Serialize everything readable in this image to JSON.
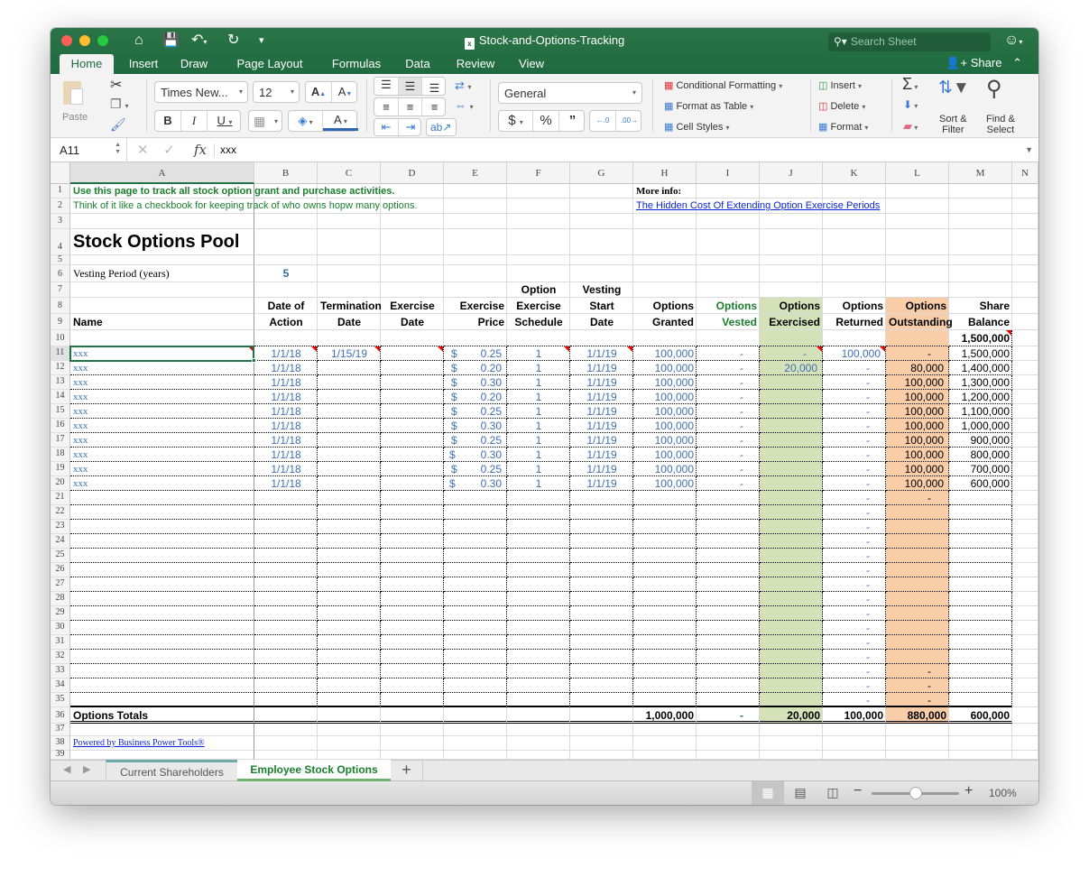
{
  "window": {
    "title": "Stock-and-Options-Tracking",
    "search_placeholder": "Search Sheet",
    "share_label": "Share"
  },
  "ribbon_tabs": [
    "Home",
    "Insert",
    "Draw",
    "Page Layout",
    "Formulas",
    "Data",
    "Review",
    "View"
  ],
  "ribbon": {
    "paste_label": "Paste",
    "font_name": "Times New...",
    "font_size": "12",
    "number_format": "General",
    "conditional_formatting": "Conditional Formatting",
    "format_as_table": "Format as Table",
    "cell_styles": "Cell Styles",
    "insert": "Insert",
    "delete": "Delete",
    "format": "Format",
    "sort_filter": [
      "Sort &",
      "Filter"
    ],
    "find_select": [
      "Find &",
      "Select"
    ]
  },
  "formula_bar": {
    "name_box": "A11",
    "value": "xxx"
  },
  "columns": [
    "A",
    "B",
    "C",
    "D",
    "E",
    "F",
    "G",
    "H",
    "I",
    "J",
    "K",
    "L",
    "M",
    "N"
  ],
  "sheet": {
    "intro_line1": "Use this page to track all stock option grant and purchase activities.",
    "intro_line2": "Think of it like a checkbook for keeping track of who owns hopw many options.",
    "more_info_label": "More info:",
    "more_info_link": "The Hidden Cost Of Extending Option Exercise Periods",
    "title": "Stock Options Pool",
    "vesting_label": "Vesting Period (years)",
    "vesting_value": "5",
    "headers": {
      "name": "Name",
      "date_of_action": [
        "Date of",
        "Action"
      ],
      "termination_date": [
        "Termination",
        "Date"
      ],
      "exercise_date": [
        "Exercise",
        "Date"
      ],
      "exercise_price": [
        "Exercise",
        "Price"
      ],
      "option_exercise_schedule": [
        "Option",
        "Exercise",
        "Schedule"
      ],
      "vesting_start_date": [
        "Vesting",
        "Start",
        "Date"
      ],
      "options_granted": [
        "Options",
        "Granted"
      ],
      "options_vested": [
        "Options",
        "Vested"
      ],
      "options_exercised": [
        "Options",
        "Exercised"
      ],
      "options_returned": [
        "Options",
        "Returned"
      ],
      "options_outstanding": [
        "Options",
        "Outstanding"
      ],
      "share_balance": [
        "Share",
        "Balance"
      ]
    },
    "starting_balance": "1,500,000",
    "rows": [
      {
        "name": "xxx",
        "date": "1/1/18",
        "term": "1/15/19",
        "exdate": "",
        "cur": "$",
        "price": "0.25",
        "sched": "1",
        "vstart": "1/1/19",
        "granted": "100,000",
        "vested": "-",
        "exercised": "-",
        "returned": "100,000",
        "outstanding": "-",
        "balance": "1,500,000"
      },
      {
        "name": "xxx",
        "date": "1/1/18",
        "term": "",
        "exdate": "",
        "cur": "$",
        "price": "0.20",
        "sched": "1",
        "vstart": "1/1/19",
        "granted": "100,000",
        "vested": "-",
        "exercised": "20,000",
        "returned": "-",
        "outstanding": "80,000",
        "balance": "1,400,000"
      },
      {
        "name": "xxx",
        "date": "1/1/18",
        "term": "",
        "exdate": "",
        "cur": "$",
        "price": "0.30",
        "sched": "1",
        "vstart": "1/1/19",
        "granted": "100,000",
        "vested": "-",
        "exercised": "",
        "returned": "-",
        "outstanding": "100,000",
        "balance": "1,300,000"
      },
      {
        "name": "xxx",
        "date": "1/1/18",
        "term": "",
        "exdate": "",
        "cur": "$",
        "price": "0.20",
        "sched": "1",
        "vstart": "1/1/19",
        "granted": "100,000",
        "vested": "-",
        "exercised": "",
        "returned": "-",
        "outstanding": "100,000",
        "balance": "1,200,000"
      },
      {
        "name": "xxx",
        "date": "1/1/18",
        "term": "",
        "exdate": "",
        "cur": "$",
        "price": "0.25",
        "sched": "1",
        "vstart": "1/1/19",
        "granted": "100,000",
        "vested": "-",
        "exercised": "",
        "returned": "-",
        "outstanding": "100,000",
        "balance": "1,100,000"
      },
      {
        "name": "xxx",
        "date": "1/1/18",
        "term": "",
        "exdate": "",
        "cur": "$",
        "price": "0.30",
        "sched": "1",
        "vstart": "1/1/19",
        "granted": "100,000",
        "vested": "-",
        "exercised": "",
        "returned": "-",
        "outstanding": "100,000",
        "balance": "1,000,000"
      },
      {
        "name": "xxx",
        "date": "1/1/18",
        "term": "",
        "exdate": "",
        "cur": "$",
        "price": "0.25",
        "sched": "1",
        "vstart": "1/1/19",
        "granted": "100,000",
        "vested": "-",
        "exercised": "",
        "returned": "-",
        "outstanding": "100,000",
        "balance": "900,000"
      },
      {
        "name": "xxx",
        "date": "1/1/18",
        "term": "",
        "exdate": "",
        "cur": "$",
        "price": "0.30",
        "sched": "1",
        "vstart": "1/1/19",
        "granted": "100,000",
        "vested": "-",
        "exercised": "",
        "returned": "-",
        "outstanding": "100,000",
        "balance": "800,000"
      },
      {
        "name": "xxx",
        "date": "1/1/18",
        "term": "",
        "exdate": "",
        "cur": "$",
        "price": "0.25",
        "sched": "1",
        "vstart": "1/1/19",
        "granted": "100,000",
        "vested": "-",
        "exercised": "",
        "returned": "-",
        "outstanding": "100,000",
        "balance": "700,000"
      },
      {
        "name": "xxx",
        "date": "1/1/18",
        "term": "",
        "exdate": "",
        "cur": "$",
        "price": "0.30",
        "sched": "1",
        "vstart": "1/1/19",
        "granted": "100,000",
        "vested": "-",
        "exercised": "",
        "returned": "-",
        "outstanding": "100,000",
        "balance": "600,000"
      }
    ],
    "empty_row_dashes": {
      "returned": "-",
      "outstanding_rows": [
        21,
        33,
        34,
        35
      ]
    },
    "totals": {
      "label": "Options Totals",
      "granted": "1,000,000",
      "vested": "-",
      "exercised": "20,000",
      "returned": "100,000",
      "outstanding": "880,000",
      "balance": "600,000"
    },
    "powered_by": "Powered by Business Power Tools®"
  },
  "sheet_tabs": [
    {
      "label": "Current Shareholders",
      "active": false
    },
    {
      "label": "Employee Stock Options",
      "active": true
    }
  ],
  "status": {
    "zoom": "100%",
    "zoom_fraction": 0.5
  },
  "colors": {
    "brand": "#217346",
    "exercised_fill": "#d5e2b9",
    "outstanding_fill": "#f8cda8",
    "input_blue": "#3f6fb5",
    "note_green": "#1a7e2c"
  }
}
